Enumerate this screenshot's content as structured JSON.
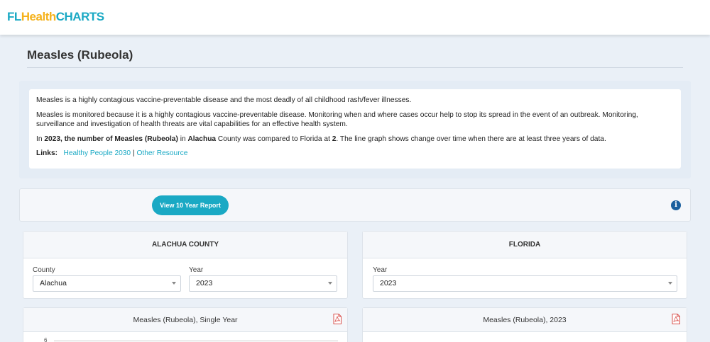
{
  "header": {
    "logo_fl": "FL",
    "logo_health": "Health",
    "logo_charts": "CHARTS"
  },
  "page": {
    "title": "Measles (Rubeola)"
  },
  "description": {
    "para1": "Measles is a highly contagious vaccine-preventable disease and the most deadly of all childhood rash/fever illnesses.",
    "para2": "Measles is monitored because it is a highly contagious vaccine-preventable disease. Monitoring when and where cases occur help to stop its spread in the event of an outbreak. Monitoring, surveillance and investigation of health threats are vital capabilities for an effective health system.",
    "para3_in": "In ",
    "para3_bold1": "2023, the number of Measles (Rubeola)",
    "para3_mid": " in ",
    "para3_bold2": "Alachua",
    "para3_mid2": " County was compared to Florida at ",
    "para3_bold3": "2",
    "para3_end": ". The line graph shows change over time when there are at least three years of data.",
    "links_label": "Links:",
    "link1": "Healthy People 2030",
    "link_sep": "|",
    "link2": "Other Resource"
  },
  "toolbar": {
    "report_button": "View 10 Year Report",
    "info_icon": "i"
  },
  "county_card": {
    "title": "ALACHUA COUNTY",
    "county_label": "County",
    "county_value": "Alachua",
    "year_label": "Year",
    "year_value": "2023"
  },
  "state_card": {
    "title": "FLORIDA",
    "year_label": "Year",
    "year_value": "2023"
  },
  "charts": {
    "left_title": "Measles (Rubeola), Single Year",
    "right_title": "Measles (Rubeola), 2023",
    "left_first_tick": "6"
  }
}
